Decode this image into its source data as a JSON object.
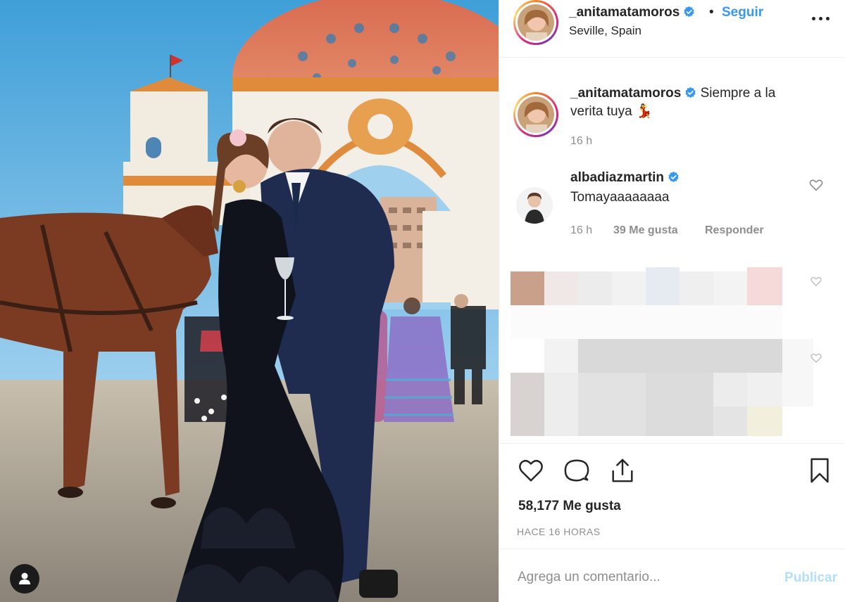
{
  "post": {
    "author": "_anitamatamoros",
    "location": "Seville, Spain",
    "follow_label": "Seguir",
    "separator": "•",
    "more_icon": "more-horizontal-icon"
  },
  "caption": {
    "author": "_anitamatamoros",
    "text": "Siempre a la verita tuya",
    "emoji": "💃",
    "time": "16 h"
  },
  "comment": {
    "author": "albadiazmartin",
    "text": "Tomayaaaaaaaa",
    "time": "16 h",
    "likes": "39 Me gusta",
    "reply_label": "Responder"
  },
  "actions": {
    "like_icon": "heart-outline-icon",
    "comment_icon": "speech-bubble-icon",
    "share_icon": "share-icon",
    "save_icon": "bookmark-icon"
  },
  "stats": {
    "likes": "58,177 Me gusta",
    "age": "HACE 16 HORAS"
  },
  "composer": {
    "placeholder": "Agrega un comentario...",
    "post_label": "Publicar"
  },
  "colors": {
    "link_blue": "#3897f0",
    "post_disabled": "#b2dffc",
    "verified_blue": "#3897f0",
    "muted": "#8e8e8e"
  }
}
